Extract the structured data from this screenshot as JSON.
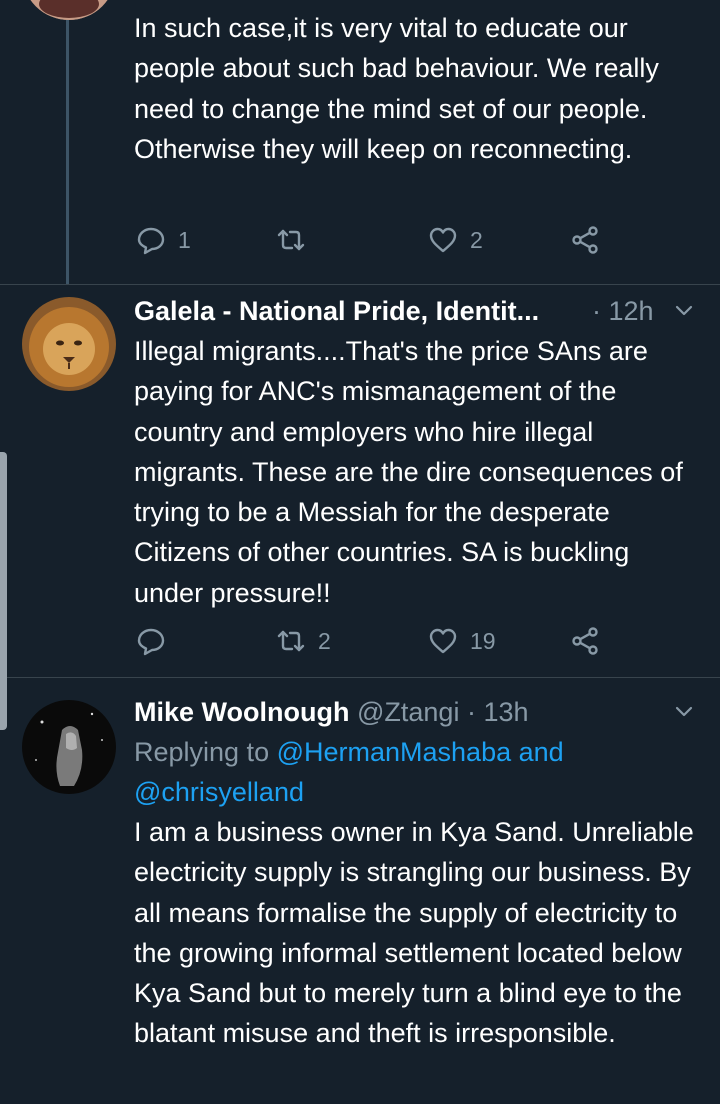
{
  "tweets": [
    {
      "text": "In such case,it is very vital to educate our people about such bad behaviour. We really need to change the mind set of our people. Otherwise they will keep on reconnecting.",
      "actions": {
        "reply_count": "1",
        "retweet_count": "",
        "like_count": "2"
      }
    },
    {
      "display_name": "Galela - National Pride, Identit...",
      "time": "· 12h",
      "text": "Illegal migrants....That's the price SAns are paying for ANC's mismanagement of the country and employers who hire illegal migrants. These are the dire consequences of trying to be a Messiah for the desperate Citizens of other countries. SA is buckling under pressure!!",
      "actions": {
        "reply_count": "",
        "retweet_count": "2",
        "like_count": "19"
      }
    },
    {
      "display_name": "Mike Woolnough",
      "handle": "@Ztangi",
      "time": "· 13h",
      "replying_prefix": "Replying to ",
      "replying_user1": "@HermanMashaba",
      "replying_and": " and",
      "replying_user2": "@chrisyelland",
      "text": "I am a business owner in Kya Sand. Unreliable electricity supply is strangling our business. By all means formalise the supply of electricity to the growing informal settlement located below Kya Sand but to merely turn a blind eye to the blatant misuse and theft is irresponsible."
    }
  ],
  "icons": {
    "reply": "reply-icon",
    "retweet": "retweet-icon",
    "like": "heart-icon",
    "share": "share-icon",
    "more": "chevron-down-icon"
  },
  "colors": {
    "background": "#15202b",
    "secondary_text": "#8899a6",
    "link": "#1da1f2",
    "divider": "#38444d"
  }
}
